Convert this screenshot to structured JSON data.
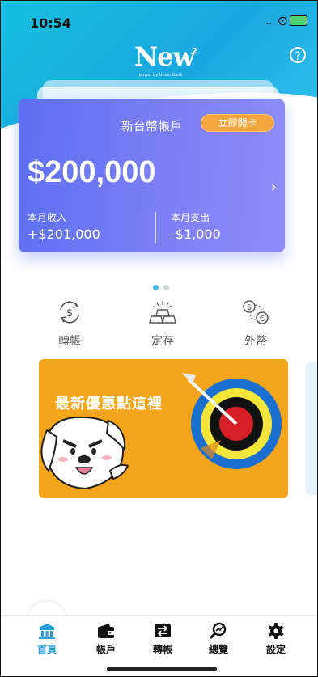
{
  "status": {
    "time": "10:54",
    "signal": "...",
    "battery": "charging"
  },
  "brand": {
    "logo": "New",
    "logo_sup": "2",
    "logo_sub": "power by Union Bank"
  },
  "help_label": "?",
  "card": {
    "title": "新台幣帳戶",
    "open_button": "立即開卡",
    "balance": "$200,000",
    "income_label": "本月收入",
    "income_value": "+$201,000",
    "spend_label": "本月支出",
    "spend_value": "-$1,000",
    "chevron": "›"
  },
  "pager": {
    "count": 2,
    "active": 1,
    "active_color": "#48b7ec",
    "inactive_color": "#cfd4d8"
  },
  "quick_actions": [
    {
      "label": "轉帳",
      "icon": "transfer-icon"
    },
    {
      "label": "定存",
      "icon": "deposit-icon"
    },
    {
      "label": "外幣",
      "icon": "foreign-currency-icon"
    }
  ],
  "banner": {
    "title": "最新優惠點這裡"
  },
  "tabbar": [
    {
      "label": "首頁",
      "icon": "home-bank-icon",
      "active": true,
      "color": "#2a9fd6"
    },
    {
      "label": "帳戶",
      "icon": "wallet-icon",
      "active": false
    },
    {
      "label": "轉帳",
      "icon": "transfer-tab-icon",
      "active": false
    },
    {
      "label": "總覽",
      "icon": "overview-icon",
      "active": false
    },
    {
      "label": "設定",
      "icon": "settings-icon",
      "active": false
    }
  ]
}
